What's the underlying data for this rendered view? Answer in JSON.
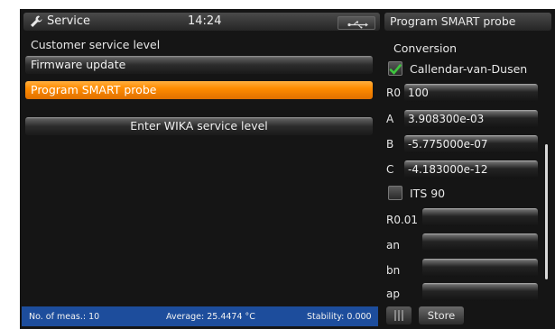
{
  "header": {
    "title": "Service",
    "time": "14:24",
    "icons": {
      "service": "wrench-icon",
      "usb": "usb-icon"
    }
  },
  "left": {
    "section_label": "Customer service level",
    "buttons": [
      {
        "label": "Firmware update",
        "active": false
      },
      {
        "label": "Program SMART probe",
        "active": true
      },
      {
        "label": "Enter WIKA service level",
        "active": false
      }
    ]
  },
  "right": {
    "title": "Program SMART probe",
    "conversion_label": "Conversion",
    "cvd": {
      "label": "Callendar-van-Dusen",
      "checked": true
    },
    "params": [
      {
        "label": "R0",
        "value": "100"
      },
      {
        "label": "A",
        "value": "3.908300e-03"
      },
      {
        "label": "B",
        "value": "-5.775000e-07"
      },
      {
        "label": "C",
        "value": "-4.183000e-12"
      }
    ],
    "its90": {
      "label": "ITS 90",
      "checked": false
    },
    "its_params": [
      {
        "label": "R0.01",
        "value": ""
      },
      {
        "label": "an",
        "value": ""
      },
      {
        "label": "bn",
        "value": ""
      },
      {
        "label": "ap",
        "value": ""
      }
    ]
  },
  "status": {
    "meas": "No. of meas.: 10",
    "average": "Average: 25.4474 °C",
    "stability": "Stability: 0.000"
  },
  "footer": {
    "store_label": "Store"
  },
  "colors": {
    "accent": "#ff8c00",
    "status_bar": "#1d4d9c",
    "check": "#3ec63e"
  }
}
